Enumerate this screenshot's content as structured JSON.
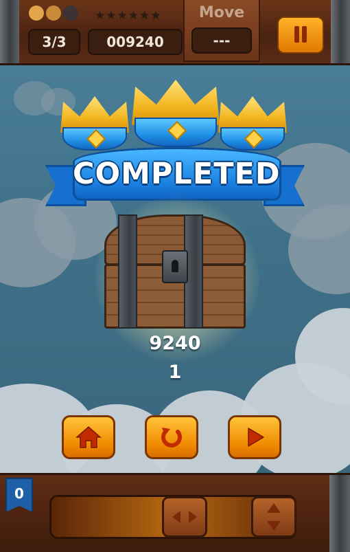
{
  "header": {
    "lives": "3/3",
    "score": "009240",
    "move_label": "Move",
    "move_value": "---",
    "stars_total": 6
  },
  "result": {
    "title": "COMPLETED",
    "score": "9240",
    "stars": "1",
    "crowns": 3
  },
  "actions": {
    "home_icon": "home-icon",
    "replay_icon": "replay-icon",
    "next_icon": "play-icon"
  },
  "bottom": {
    "counter": "0"
  },
  "colors": {
    "ribbon_blue": "#1a7fe0",
    "crown_gold": "#f2b51e",
    "button_orange": "#f08a00",
    "wood_brown": "#5e2d15"
  }
}
